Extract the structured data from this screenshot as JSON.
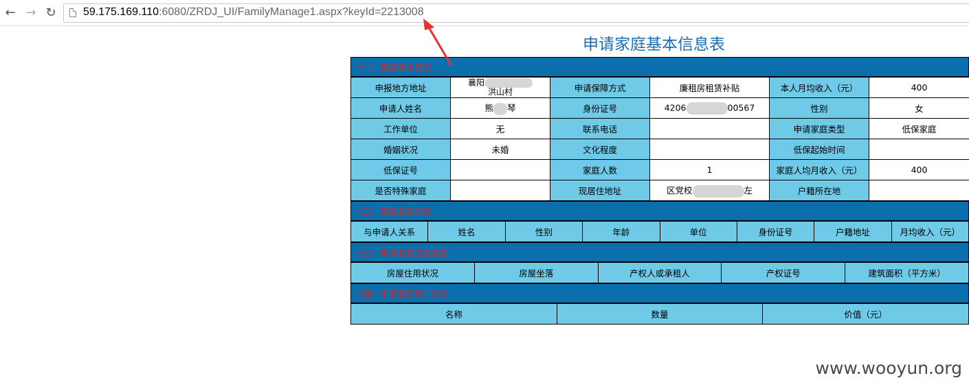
{
  "browser": {
    "url_host": "59.175.169.110",
    "url_rest": ":6080/ZRDJ_UI/FamilyManage1.aspx?keyId=2213008",
    "back_icon": "←",
    "forward_icon": "→",
    "reload_icon": "↻"
  },
  "page": {
    "title": "申请家庭基本信息表"
  },
  "sections": {
    "basic": "（一）家庭基本情况",
    "members": "（二）家庭成员信息",
    "housing": "（三）申请家庭住房信息",
    "assets": "（四）申请家庭资产信息"
  },
  "basic": {
    "address_label": "申报地方地址",
    "address_value_1": "襄阳",
    "address_value_2": "洪山村",
    "apply_mode_label": "申请保障方式",
    "apply_mode_value": "廉租房租赁补贴",
    "self_income_label": "本人月均收入（元）",
    "self_income_value": "400",
    "name_label": "申请人姓名",
    "name_value_1": "熊",
    "name_value_2": "琴",
    "id_label": "身份证号",
    "id_value_1": "4206",
    "id_value_2": "00567",
    "gender_label": "性别",
    "gender_value": "女",
    "work_label": "工作单位",
    "work_value": "无",
    "phone_label": "联系电话",
    "phone_value": "",
    "family_type_label": "申请家庭类型",
    "family_type_value": "低保家庭",
    "marriage_label": "婚姻状况",
    "marriage_value": "未婚",
    "edu_label": "文化程度",
    "edu_value": "",
    "dibao_start_label": "低保起始时间",
    "dibao_start_value": "",
    "dibao_no_label": "低保证号",
    "dibao_no_value": "",
    "members_count_label": "家庭人数",
    "members_count_value": "1",
    "avg_income_label": "家庭人均月收入（元）",
    "avg_income_value": "400",
    "special_label": "是否特殊家庭",
    "special_value": "",
    "current_addr_label": "现居住地址",
    "current_addr_value_1": "区党校",
    "current_addr_value_2": "左",
    "hukou_label": "户籍所在地",
    "hukou_value": ""
  },
  "members_headers": [
    "与申请人关系",
    "姓名",
    "性别",
    "年龄",
    "单位",
    "身份证号",
    "户籍地址",
    "月均收入（元）"
  ],
  "housing_headers": [
    "房屋住用状况",
    "房屋坐落",
    "产权人或承租人",
    "产权证号",
    "建筑面积（平方米）"
  ],
  "assets_headers": [
    "名称",
    "数量",
    "价值（元）"
  ],
  "watermark": "www.wooyun.org",
  "colors": {
    "section_bg": "#0b6fad",
    "section_text": "#e02020",
    "label_bg": "#6fcae8",
    "title": "#1a6fb3",
    "arrow": "#e53030"
  }
}
